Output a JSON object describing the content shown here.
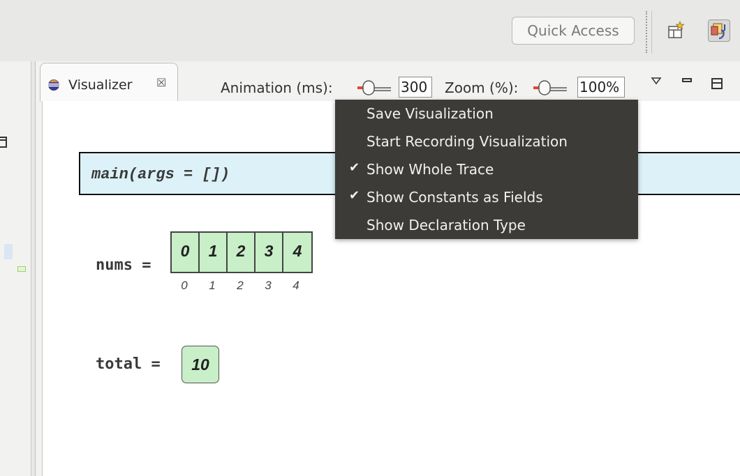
{
  "toolbar": {
    "quick_access": "Quick Access",
    "icons": [
      "open-perspective-icon",
      "java-perspective-icon"
    ]
  },
  "view": {
    "tab_title": "Visualizer",
    "tab_close_glyph": "☒",
    "animation_label": "Animation (ms):",
    "animation_value": "300",
    "zoom_label": "Zoom (%):",
    "zoom_value": "100%"
  },
  "menu": {
    "items": [
      {
        "label": "Save Visualization",
        "checked": false
      },
      {
        "label": "Start Recording Visualization",
        "checked": false
      },
      {
        "label": "Show Whole Trace",
        "checked": true
      },
      {
        "label": "Show Constants as Fields",
        "checked": true
      },
      {
        "label": "Show Declaration Type",
        "checked": false
      }
    ],
    "check_glyph": "✔"
  },
  "visualization": {
    "frame_label": "main(args = [])",
    "nums_label": "nums =",
    "nums_values": [
      "0",
      "1",
      "2",
      "3",
      "4"
    ],
    "nums_indices": [
      "0",
      "1",
      "2",
      "3",
      "4"
    ],
    "total_label": "total =",
    "total_value": "10"
  },
  "colors": {
    "menu_bg": "#3c3b37",
    "frame_bg": "#dcf2f8",
    "cell_bg": "#c8efc8"
  }
}
